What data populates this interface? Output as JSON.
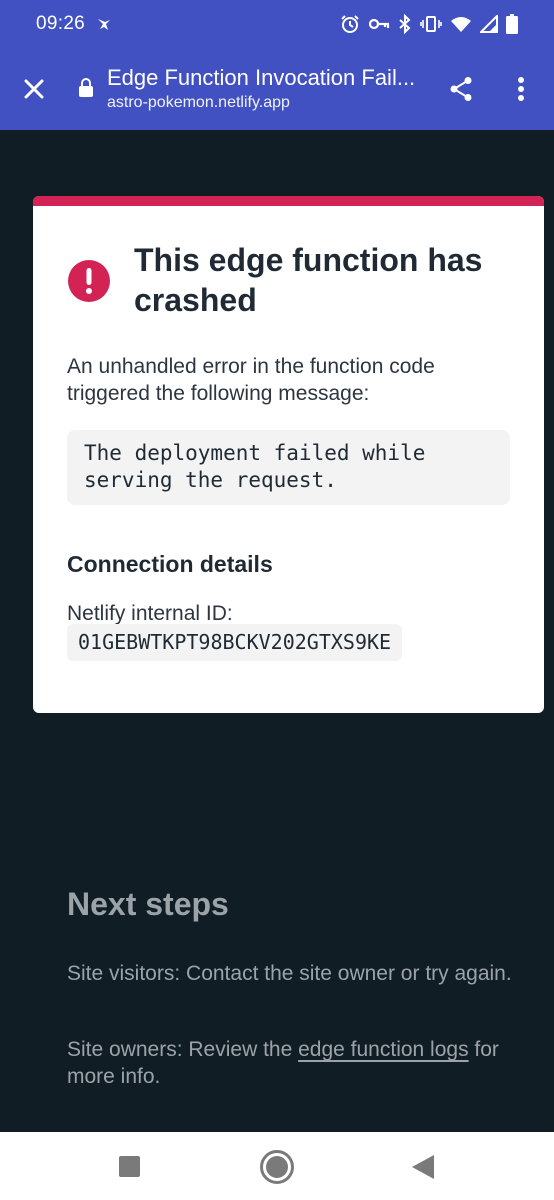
{
  "status_bar": {
    "time": "09:26",
    "icons": [
      "notification-icon",
      "alarm-icon",
      "vpn-key-icon",
      "bluetooth-icon",
      "vibrate-icon",
      "wifi-icon",
      "signal-icon",
      "battery-icon"
    ]
  },
  "browser": {
    "title": "Edge Function Invocation Fail...",
    "url": "astro-pokemon.netlify.app",
    "accent": "#4151c1"
  },
  "error_card": {
    "heading": "This edge function has crashed",
    "description": "An unhandled error in the function code triggered the following message:",
    "message": "The deployment failed while serving the request.",
    "connection_heading": "Connection details",
    "id_label": "Netlify internal ID:",
    "id_value": "01GEBWTKPT98BCKV202GTXS9KE",
    "accent": "#d32254"
  },
  "next_steps": {
    "heading": "Next steps",
    "visitors_text": "Site visitors: Contact the site owner or try again.",
    "owners_prefix": "Site owners: Review the ",
    "owners_link": "edge function logs",
    "owners_suffix": " for more info."
  },
  "nav_bar": {
    "icons": [
      "recents-icon",
      "home-icon",
      "back-icon"
    ]
  }
}
